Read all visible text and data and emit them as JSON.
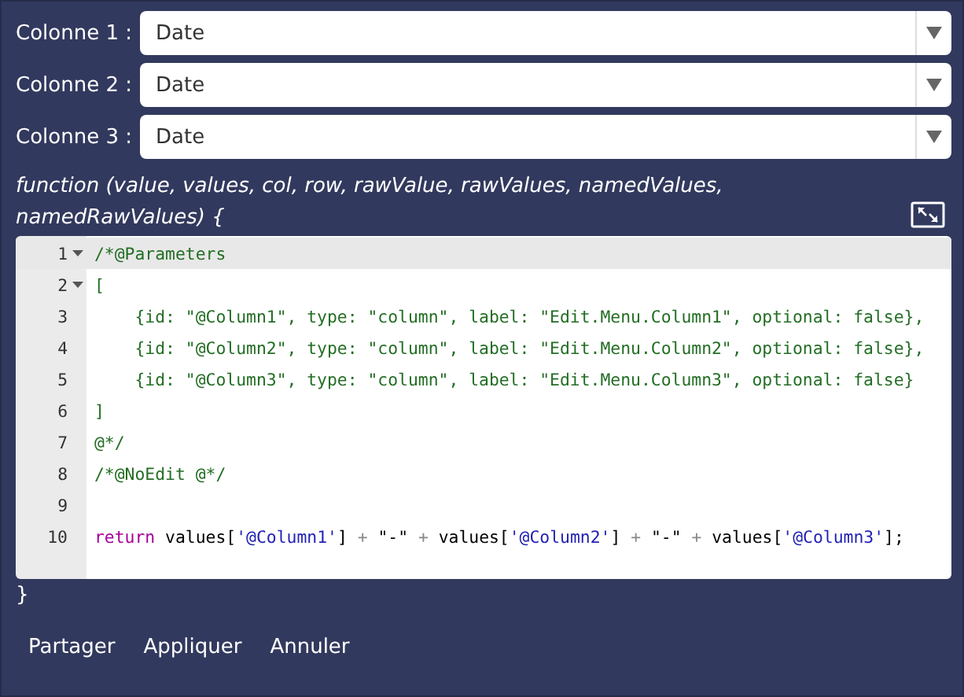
{
  "columns": [
    {
      "label": "Colonne 1 :",
      "value": "Date"
    },
    {
      "label": "Colonne 2 :",
      "value": "Date"
    },
    {
      "label": "Colonne 3 :",
      "value": "Date"
    }
  ],
  "signature": "function (value, values, col, row, rawValue, rawValues, namedValues, namedRawValues) {",
  "editor": {
    "lines": [
      {
        "number": "1",
        "foldable": true,
        "active": true,
        "tokens": [
          {
            "kind": "comment",
            "text": "/*@Parameters"
          }
        ]
      },
      {
        "number": "2",
        "foldable": true,
        "active": false,
        "tokens": [
          {
            "kind": "comment",
            "text": "["
          }
        ]
      },
      {
        "number": "3",
        "foldable": false,
        "active": false,
        "tokens": [
          {
            "kind": "comment",
            "text": "    {id: \"@Column1\", type: \"column\", label: \"Edit.Menu.Column1\", optional: false},"
          }
        ]
      },
      {
        "number": "4",
        "foldable": false,
        "active": false,
        "tokens": [
          {
            "kind": "comment",
            "text": "    {id: \"@Column2\", type: \"column\", label: \"Edit.Menu.Column2\", optional: false},"
          }
        ]
      },
      {
        "number": "5",
        "foldable": false,
        "active": false,
        "tokens": [
          {
            "kind": "comment",
            "text": "    {id: \"@Column3\", type: \"column\", label: \"Edit.Menu.Column3\", optional: false}"
          }
        ]
      },
      {
        "number": "6",
        "foldable": false,
        "active": false,
        "tokens": [
          {
            "kind": "comment",
            "text": "]"
          }
        ]
      },
      {
        "number": "7",
        "foldable": false,
        "active": false,
        "tokens": [
          {
            "kind": "comment",
            "text": "@*/"
          }
        ]
      },
      {
        "number": "8",
        "foldable": false,
        "active": false,
        "tokens": [
          {
            "kind": "comment",
            "text": "/*@NoEdit @*/"
          }
        ]
      },
      {
        "number": "9",
        "foldable": false,
        "active": false
      },
      {
        "number": "10",
        "foldable": false,
        "active": false,
        "tokens": [
          {
            "kind": "keyword",
            "text": "return"
          },
          {
            "kind": "plain",
            "text": " values["
          },
          {
            "kind": "string",
            "text": "'@Column1'"
          },
          {
            "kind": "plain",
            "text": "]"
          },
          {
            "kind": "operator",
            "text": " + "
          },
          {
            "kind": "plain",
            "text": "\"-\""
          },
          {
            "kind": "operator",
            "text": " + "
          },
          {
            "kind": "plain",
            "text": "values["
          },
          {
            "kind": "string",
            "text": "'@Column2'"
          },
          {
            "kind": "plain",
            "text": "]"
          },
          {
            "kind": "operator",
            "text": " + "
          },
          {
            "kind": "plain",
            "text": "\"-\""
          },
          {
            "kind": "operator",
            "text": " + "
          },
          {
            "kind": "plain",
            "text": "values["
          },
          {
            "kind": "string",
            "text": "'@Column3'"
          },
          {
            "kind": "plain",
            "text": "];"
          }
        ]
      }
    ]
  },
  "closing": "}",
  "buttons": [
    "Partager",
    "Appliquer",
    "Annuler"
  ]
}
